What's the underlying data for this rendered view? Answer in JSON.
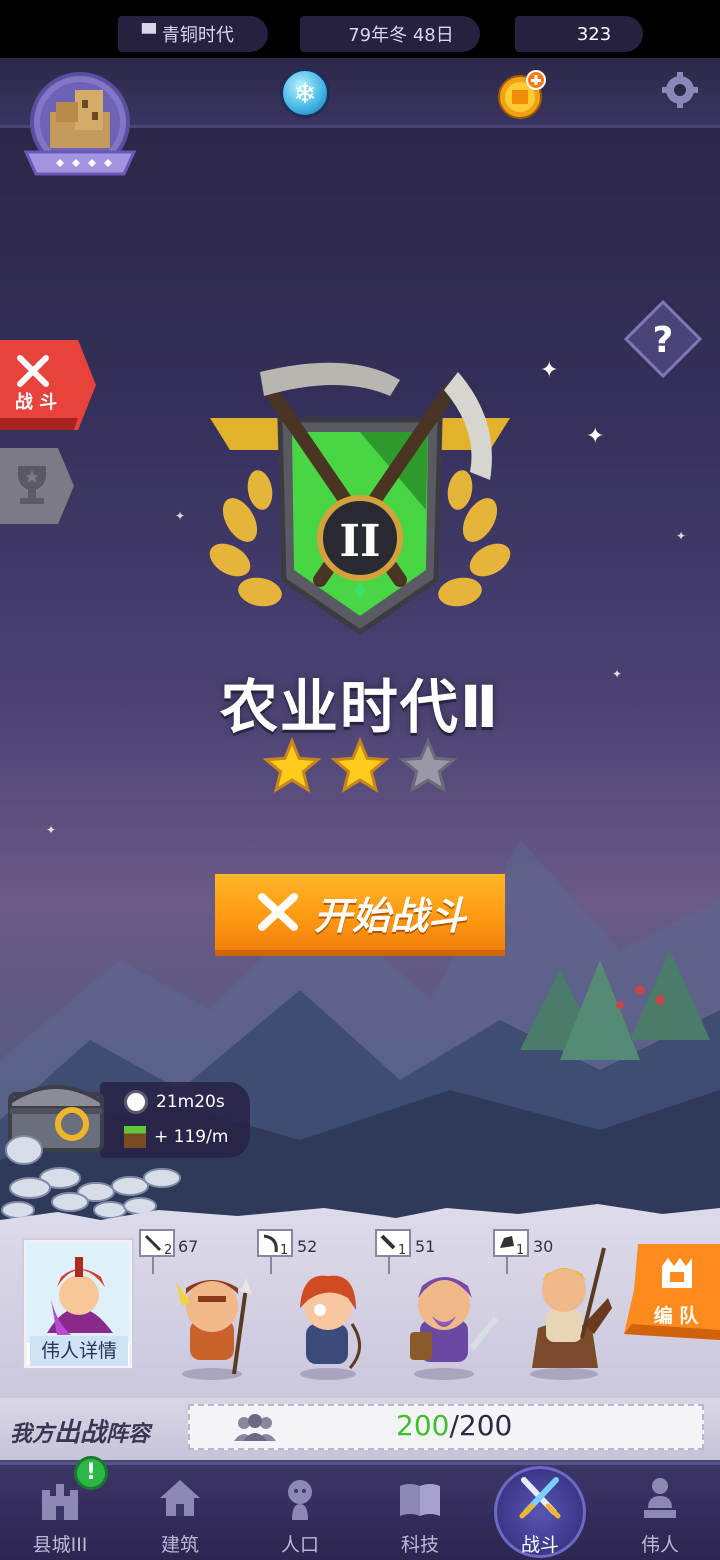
{
  "header": {
    "era": "青铜时代",
    "date": "79年冬 48日",
    "gold": "323"
  },
  "side": {
    "battle_tab": "战 斗"
  },
  "stage": {
    "title": "农业时代Ⅱ",
    "badge_numeral": "II",
    "stars_earned": 2,
    "stars_total": 3,
    "start_button": "开始战斗"
  },
  "chest": {
    "timer": "21m20s",
    "rate": "+ 119/m"
  },
  "army": {
    "hero_label": "伟人详情",
    "units": [
      {
        "level": "2",
        "count": "67",
        "weapon": "spear-icon"
      },
      {
        "level": "1",
        "count": "52",
        "weapon": "bow-icon"
      },
      {
        "level": "1",
        "count": "51",
        "weapon": "sword-icon"
      },
      {
        "level": "1",
        "count": "30",
        "weapon": "cavalry-icon"
      }
    ],
    "team_button": "编 队"
  },
  "lineup": {
    "label_a": "我方",
    "label_b": "出战",
    "label_c": "阵容",
    "pop_current": "200",
    "pop_max": "/200"
  },
  "nav": {
    "items": [
      {
        "label": "县城III",
        "icon": "castle-icon"
      },
      {
        "label": "建筑",
        "icon": "house-icon"
      },
      {
        "label": "人口",
        "icon": "person-icon"
      },
      {
        "label": "科技",
        "icon": "book-icon"
      },
      {
        "label": "战斗",
        "icon": "crossed-swords-icon"
      },
      {
        "label": "伟人",
        "icon": "statue-icon"
      }
    ],
    "active": "战斗",
    "alert": "!"
  },
  "colors": {
    "accent_orange": "#ff9b12",
    "pop_green": "#3fbf2a",
    "battle_red": "#e8423c"
  }
}
